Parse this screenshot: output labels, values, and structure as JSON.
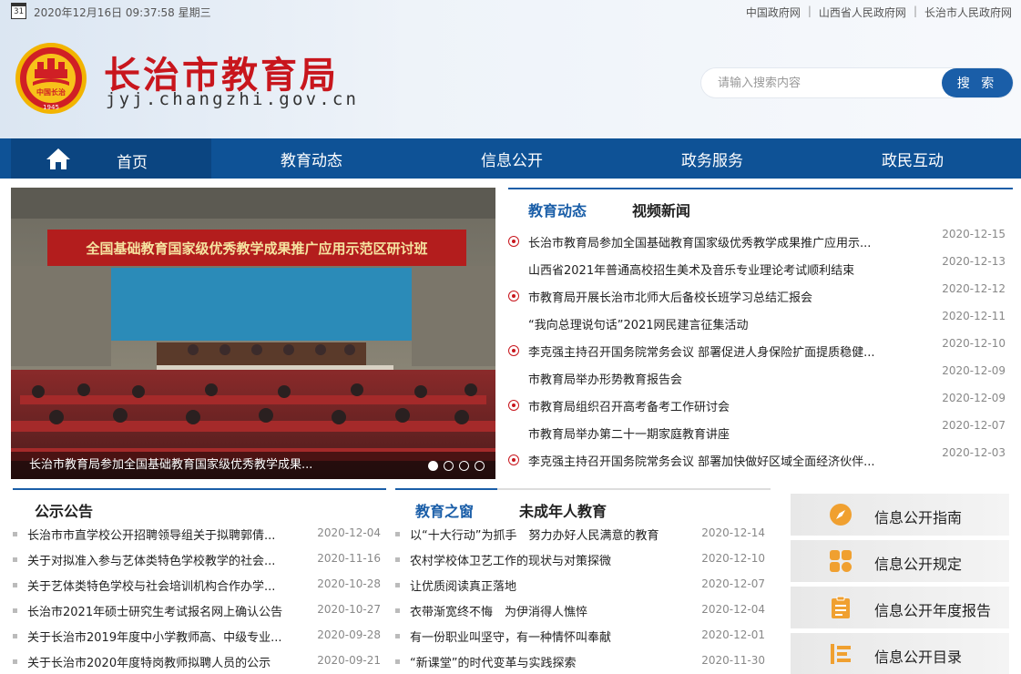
{
  "topbar": {
    "calendar_day": "31",
    "datetime": "2020年12月16日 09:37:58 星期三",
    "links": [
      "中国政府网",
      "山西省人民政府网",
      "长治市人民政府网"
    ]
  },
  "header": {
    "logo_text_top": "中国长治",
    "logo_year": "1945",
    "title": "长治市教育局",
    "domain": "jyj.changzhi.gov.cn"
  },
  "search": {
    "placeholder": "请输入搜索内容",
    "button_label": "搜 索"
  },
  "nav": {
    "items": [
      "首页",
      "教育动态",
      "信息公开",
      "政务服务",
      "政民互动"
    ]
  },
  "slider": {
    "banner": "全国基础教育国家级优秀教学成果推广应用示范区研讨班",
    "caption": "长治市教育局参加全国基础教育国家级优秀教学成果..."
  },
  "news": {
    "tabs": [
      "教育动态",
      "视频新闻"
    ],
    "items": [
      {
        "title": "长治市教育局参加全国基础教育国家级优秀教学成果推广应用示...",
        "date": "2020-12-15",
        "bullet": true
      },
      {
        "title": "山西省2021年普通高校招生美术及音乐专业理论考试顺利结束",
        "date": "2020-12-13",
        "bullet": false
      },
      {
        "title": "市教育局开展长治市北师大后备校长班学习总结汇报会",
        "date": "2020-12-12",
        "bullet": true
      },
      {
        "title": "“我向总理说句话”2021网民建言征集活动",
        "date": "2020-12-11",
        "bullet": false
      },
      {
        "title": "李克强主持召开国务院常务会议 部署促进人身保险扩面提质稳健...",
        "date": "2020-12-10",
        "bullet": true
      },
      {
        "title": "市教育局举办形势教育报告会",
        "date": "2020-12-09",
        "bullet": false
      },
      {
        "title": "市教育局组织召开高考备考工作研讨会",
        "date": "2020-12-09",
        "bullet": true
      },
      {
        "title": "市教育局举办第二十一期家庭教育讲座",
        "date": "2020-12-07",
        "bullet": false
      },
      {
        "title": "李克强主持召开国务院常务会议 部署加快做好区域全面经济伙伴...",
        "date": "2020-12-03",
        "bullet": true
      }
    ]
  },
  "notices": {
    "title": "公示公告",
    "items": [
      {
        "title": "长治市市直学校公开招聘领导组关于拟聘郭倩...",
        "date": "2020-12-04"
      },
      {
        "title": "关于对拟准入参与艺体类特色学校教学的社会...",
        "date": "2020-11-16"
      },
      {
        "title": "关于艺体类特色学校与社会培训机构合作办学...",
        "date": "2020-10-28"
      },
      {
        "title": "长治市2021年硕士研究生考试报名网上确认公告",
        "date": "2020-10-27"
      },
      {
        "title": "关于长治市2019年度中小学教师高、中级专业...",
        "date": "2020-09-28"
      },
      {
        "title": "关于长治市2020年度特岗教师拟聘人员的公示",
        "date": "2020-09-21"
      }
    ]
  },
  "window": {
    "tabs": [
      "教育之窗",
      "未成年人教育"
    ],
    "items": [
      {
        "title": "以“十大行动”为抓手　努力办好人民满意的教育",
        "date": "2020-12-14"
      },
      {
        "title": "农村学校体卫艺工作的现状与对策探微",
        "date": "2020-12-10"
      },
      {
        "title": "让优质阅读真正落地",
        "date": "2020-12-07"
      },
      {
        "title": "衣带渐宽终不悔　为伊消得人憔悴",
        "date": "2020-12-04"
      },
      {
        "title": "有一份职业叫坚守，有一种情怀叫奉献",
        "date": "2020-12-01"
      },
      {
        "title": "“新课堂”的时代变革与实践探索",
        "date": "2020-11-30"
      }
    ]
  },
  "side": {
    "items": [
      {
        "label": "信息公开指南",
        "icon": "compass-icon"
      },
      {
        "label": "信息公开规定",
        "icon": "rules-icon"
      },
      {
        "label": "信息公开年度报告",
        "icon": "report-icon"
      },
      {
        "label": "信息公开目录",
        "icon": "catalog-icon"
      }
    ]
  },
  "colors": {
    "brand_red": "#c8161d",
    "nav_blue": "#0e5296",
    "accent_blue": "#1a5ea8",
    "icon_orange": "#f0a030"
  }
}
